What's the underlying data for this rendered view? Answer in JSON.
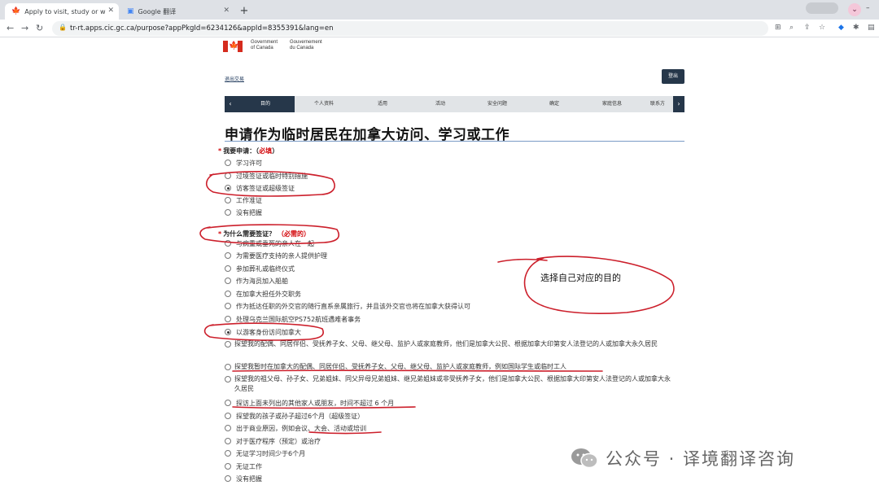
{
  "browser": {
    "tabs": [
      {
        "title": "Apply to visit, study or work in",
        "active": true
      },
      {
        "title": "Google 翻译",
        "active": false
      }
    ],
    "url": "tr-rt.apps.cic.gc.ca/purpose?appPkgId=6234126&appId=8355391&lang=en"
  },
  "gov": {
    "en_line1": "Government",
    "en_line2": "of Canada",
    "fr_line1": "Gouvernement",
    "fr_line2": "du Canada"
  },
  "header": {
    "logout_link": "退出交易",
    "logout_button": "登出"
  },
  "progress": {
    "steps": [
      "目的",
      "个人资料",
      "适用",
      "活动",
      "安全问题",
      "确定",
      "家庭信息",
      "联系方"
    ]
  },
  "page_title": "申请作为临时居民在加拿大访问、学习或工作",
  "q1": {
    "label": "我要申请：（",
    "required": "必填",
    "close": "）",
    "options": [
      "学习许可",
      "过境签证或临时特别措施",
      "访客签证或超级签证",
      "工作准证",
      "没有把握"
    ],
    "selected_index": 2
  },
  "q2": {
    "label": "为什么需要签证？",
    "required": "（必需的）",
    "options": [
      "与病重或垂死的亲人在一起",
      "为需要医疗支持的亲人提供护理",
      "参加葬礼或临终仪式",
      "作为海员加入船舶",
      "在加拿大担任外交职务",
      "作为抵达任职的外交官的随行直系亲属旅行，并且该外交官也将在加拿大获得认可",
      "处理乌克兰国际航空PS752航班遇难者事务",
      "以游客身份访问加拿大",
      "探望我的配偶、同居伴侣、受抚养子女、父母、继父母、监护人或家庭教师，他们是加拿大公民、根据加拿大印第安人法登记的人或加拿大永久居民",
      "探望我暂时在加拿大的配偶、同居伴侣、受抚养子女、父母、继父母、监护人或家庭教师，例如国际学生或临时工人",
      "探望我的祖父母、孙子女、兄弟姐妹、同父异母兄弟姐妹、继兄弟姐妹或非受抚养子女，他们是加拿大公民、根据加拿大印第安人法登记的人或加拿大永久居民",
      "探访上面未列出的其他家人或朋友，时间不超过 6 个月",
      "探望我的孩子或孙子超过6个月（超级签证）",
      "出于商业原因，例如会议、大会、活动或培训",
      "对于医疗程序（预定）或治疗",
      "无证学习时间少于6个月",
      "无证工作",
      "没有把握"
    ],
    "selected_index": 7
  },
  "annotation": {
    "note": "选择自己对应的目的",
    "ink_color": "#cc1f2b"
  },
  "watermark": {
    "text": "公众号 · 译境翻译咨询"
  }
}
